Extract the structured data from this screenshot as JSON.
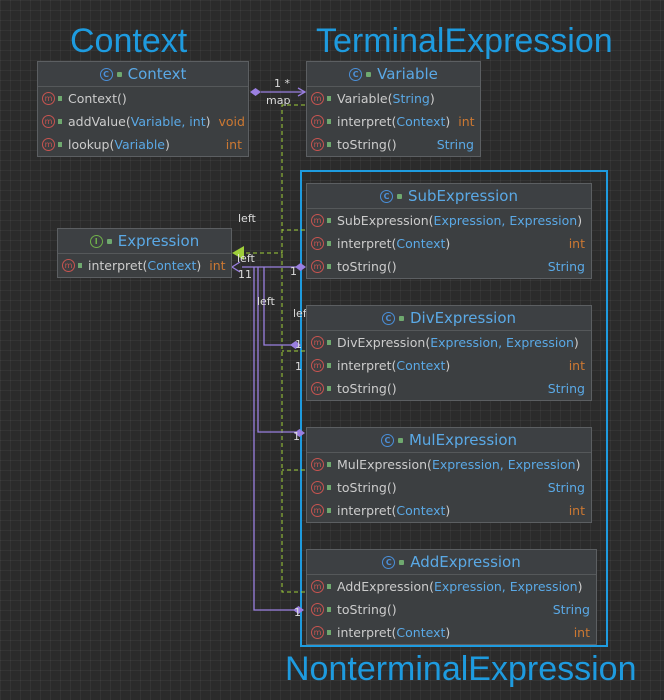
{
  "titles": {
    "context": "Context",
    "terminal": "TerminalExpression",
    "nonterminal": "NonterminalExpression"
  },
  "classes": {
    "context": {
      "name": "Context",
      "kind_icon": "class-icon",
      "members": [
        {
          "name": "Context",
          "params": "",
          "ret": ""
        },
        {
          "name": "addValue",
          "params": "Variable, int",
          "ret": "void"
        },
        {
          "name": "lookup",
          "params": "Variable",
          "ret": "int"
        }
      ]
    },
    "variable": {
      "name": "Variable",
      "kind_icon": "class-icon",
      "members": [
        {
          "name": "Variable",
          "params": "String",
          "ret": ""
        },
        {
          "name": "interpret",
          "params": "Context",
          "ret": "int"
        },
        {
          "name": "toString",
          "params": "",
          "ret": "String"
        }
      ]
    },
    "expression": {
      "name": "Expression",
      "kind_icon": "interface-icon",
      "members": [
        {
          "name": "interpret",
          "params": "Context",
          "ret": "int"
        }
      ]
    },
    "sub": {
      "name": "SubExpression",
      "kind_icon": "class-icon",
      "members": [
        {
          "name": "SubExpression",
          "params": "Expression, Expression",
          "ret": ""
        },
        {
          "name": "interpret",
          "params": "Context",
          "ret": "int"
        },
        {
          "name": "toString",
          "params": "",
          "ret": "String"
        }
      ]
    },
    "div": {
      "name": "DivExpression",
      "kind_icon": "class-icon",
      "members": [
        {
          "name": "DivExpression",
          "params": "Expression, Expression",
          "ret": ""
        },
        {
          "name": "interpret",
          "params": "Context",
          "ret": "int"
        },
        {
          "name": "toString",
          "params": "",
          "ret": "String"
        }
      ]
    },
    "mul": {
      "name": "MulExpression",
      "kind_icon": "class-icon",
      "members": [
        {
          "name": "MulExpression",
          "params": "Expression, Expression",
          "ret": ""
        },
        {
          "name": "toString",
          "params": "",
          "ret": "String"
        },
        {
          "name": "interpret",
          "params": "Context",
          "ret": "int"
        }
      ]
    },
    "add": {
      "name": "AddExpression",
      "kind_icon": "class-icon",
      "members": [
        {
          "name": "AddExpression",
          "params": "Expression, Expression",
          "ret": ""
        },
        {
          "name": "toString",
          "params": "",
          "ret": "String"
        },
        {
          "name": "interpret",
          "params": "Context",
          "ret": "int"
        }
      ]
    }
  },
  "edge_labels": {
    "map_mult": "1 *",
    "map_role": "map",
    "left_a": "left",
    "left_b": "left",
    "left_c": "left",
    "left_d": "left",
    "one_a": "1",
    "one_b": "1",
    "one_c": "1",
    "one_d": "1",
    "one_e": "1",
    "one_f": "1",
    "one_g": "11"
  },
  "colors": {
    "accent": "#1e9bdf",
    "association": "#9a7fe0",
    "realization": "#9fcf3a",
    "primitive_type": "#cc7832",
    "reference_type": "#5aa9e6"
  }
}
